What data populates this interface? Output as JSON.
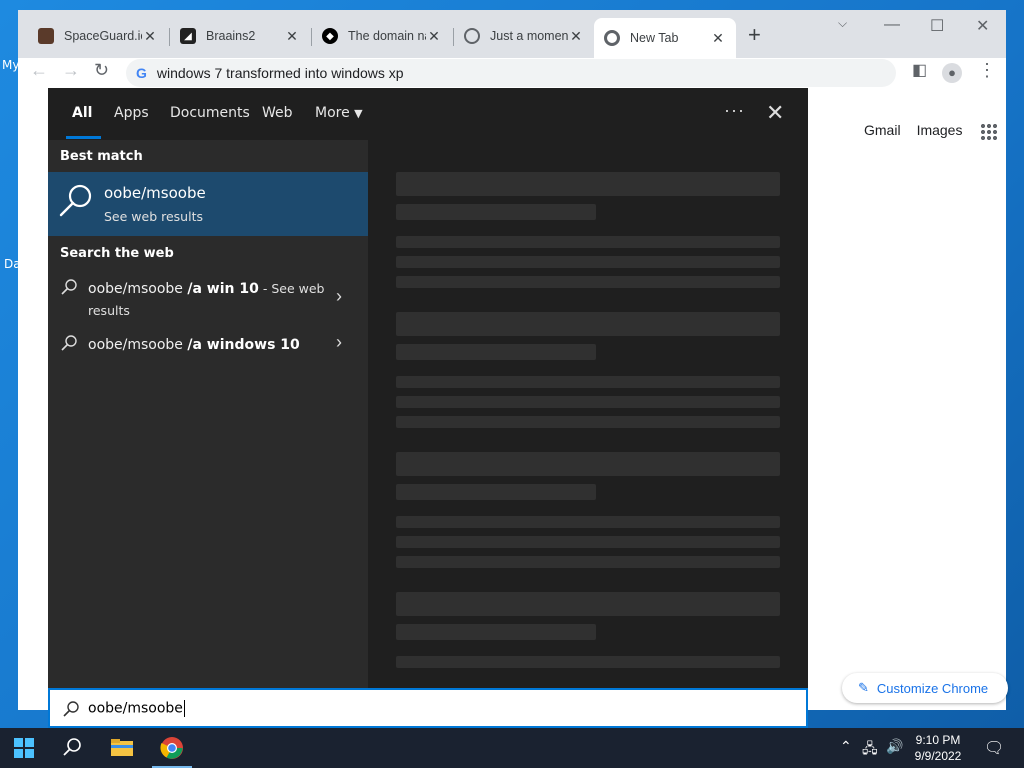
{
  "desktop": {
    "icon_labels": [
      "My",
      "Da"
    ]
  },
  "browser": {
    "tabs": [
      {
        "title": "SpaceGuard.io",
        "active": false
      },
      {
        "title": "Braains2",
        "active": false
      },
      {
        "title": "The domain na",
        "active": false
      },
      {
        "title": "Just a momen",
        "active": false
      },
      {
        "title": "New Tab",
        "active": true
      }
    ],
    "new_tab_glyph": "+",
    "address": "windows 7 transformed into windows xp",
    "ntp_links": [
      "Gmail",
      "Images"
    ],
    "customize_label": "Customize Chrome"
  },
  "search": {
    "tabs": [
      "All",
      "Apps",
      "Documents",
      "Web",
      "More"
    ],
    "best_match_heading": "Best match",
    "best_match_title": "oobe/msoobe",
    "best_match_subtitle": "See web results",
    "web_heading": "Search the web",
    "web_results": [
      {
        "prefix": "oobe/msoobe ",
        "bold": "/a win 10",
        "suffix": " - See web results"
      },
      {
        "prefix": "oobe/msoobe ",
        "bold": "/a windows 10",
        "suffix": ""
      }
    ],
    "query": "oobe/msoobe"
  },
  "taskbar": {
    "time": "9:10 PM",
    "date": "9/9/2022"
  },
  "colors": {
    "accent": "#0078d7",
    "best_match_bg": "#1d4a6e",
    "chrome_blue": "#1a73e8"
  }
}
